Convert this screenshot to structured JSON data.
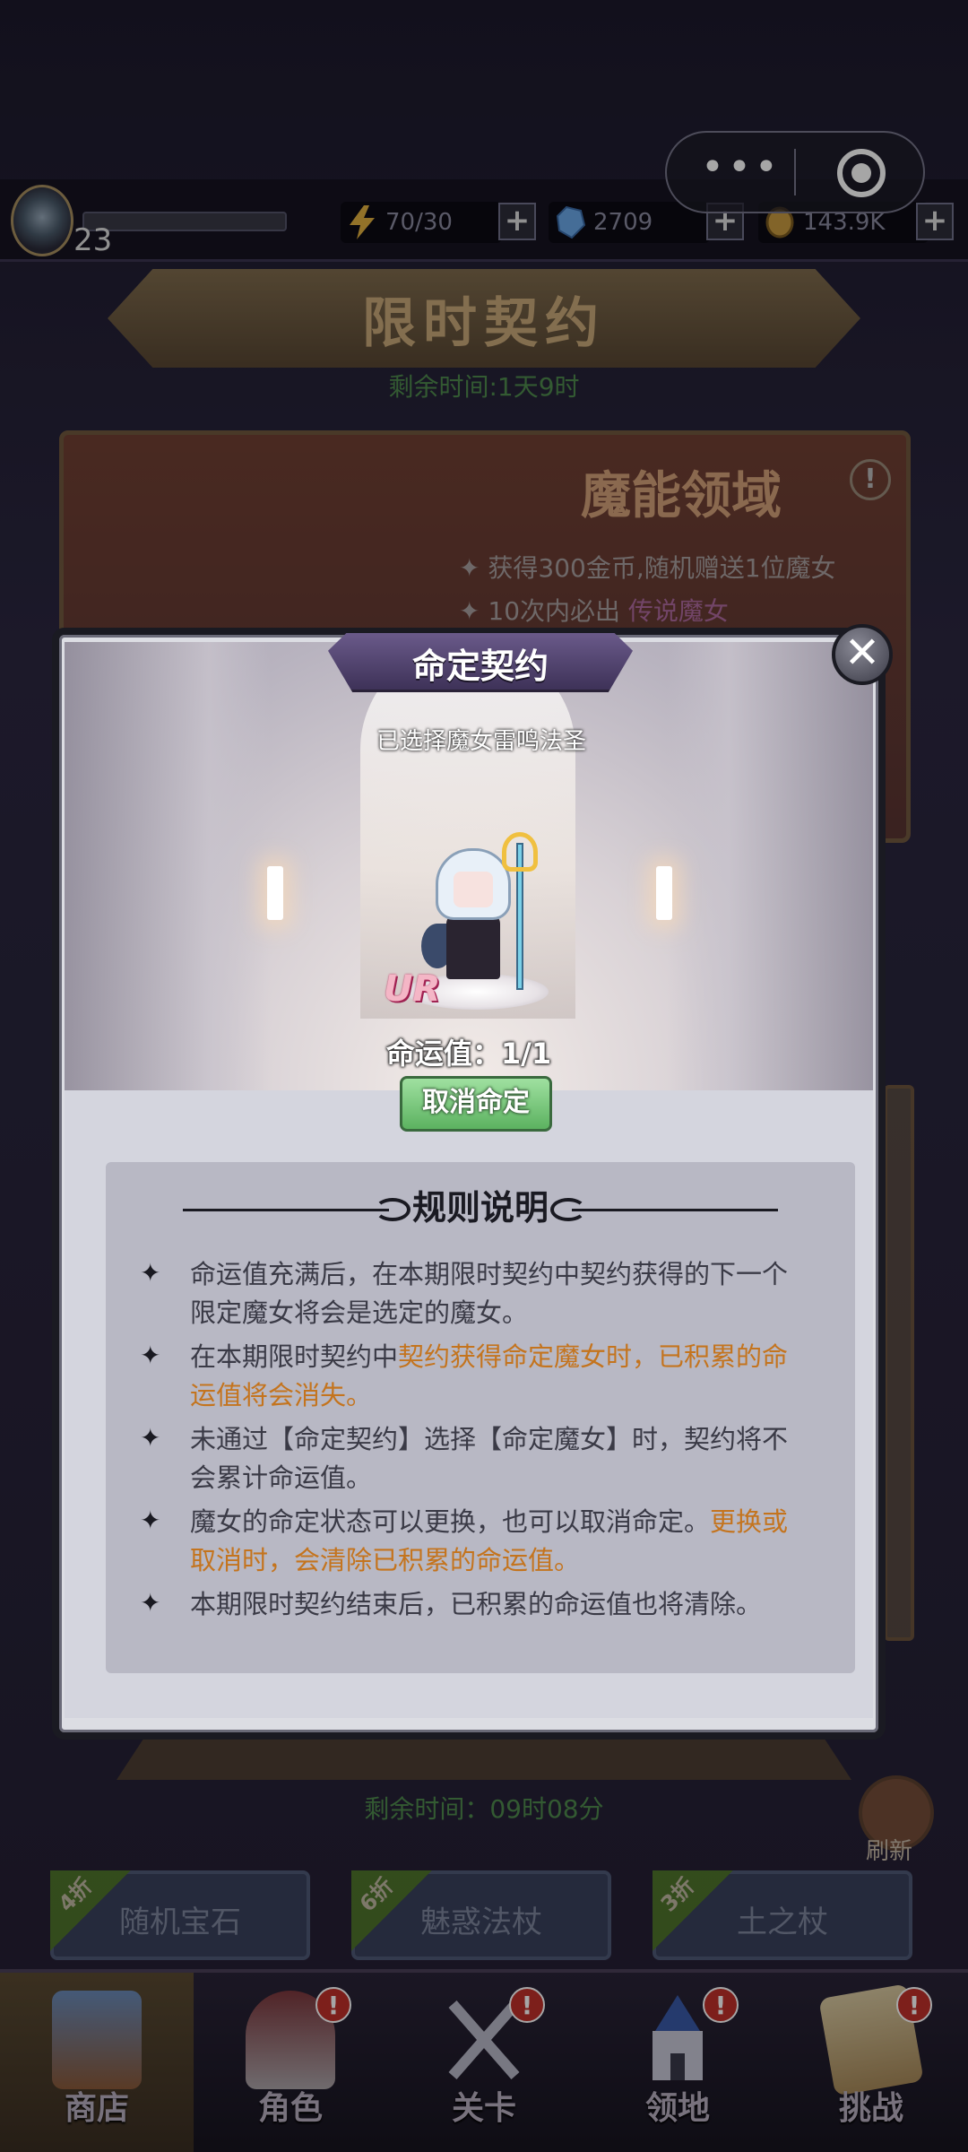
{
  "wechat_capsule": {
    "more": "•••",
    "close": "◎"
  },
  "status": {
    "level": "23",
    "energy": "70/30",
    "gems": "2709",
    "gold": "143.9K",
    "plus": "+"
  },
  "shop": {
    "banner_title": "限时契约",
    "banner_remaining": "剩余时间:1天9时",
    "event": {
      "title": "魔能领域",
      "line1": "获得300金币,随机赠送1位魔女",
      "line2_prefix": "10次内必出",
      "line2_highlight": "传说魔女"
    },
    "refresh_remaining": "剩余时间：09时08分",
    "refresh_label": "刷新",
    "items": [
      {
        "discount": "4折",
        "name": "随机宝石"
      },
      {
        "discount": "6折",
        "name": "魅惑法杖"
      },
      {
        "discount": "3折",
        "name": "土之杖"
      }
    ]
  },
  "nav": [
    {
      "label": "商店"
    },
    {
      "label": "角色",
      "badge": "!"
    },
    {
      "label": "关卡",
      "badge": "!"
    },
    {
      "label": "领地",
      "badge": "!"
    },
    {
      "label": "挑战",
      "badge": "!"
    }
  ],
  "modal": {
    "title": "命定契约",
    "close": "✕",
    "selected": "已选择魔女雷鸣法圣",
    "rarity": "UR",
    "fate_value": "命运值：1/1",
    "cancel_button": "取消命定",
    "rules_title": "规则说明",
    "rules": [
      {
        "a": "命运值充满后，在本期限时契约中契约获得的下一个限定魔女将会是选定的魔女。",
        "h": "",
        "b": ""
      },
      {
        "a": "在本期限时契约中",
        "h": "契约获得命定魔女时，已积累的命运值将会消失。",
        "b": ""
      },
      {
        "a": "未通过【命定契约】选择【命定魔女】时，契约将不会累计命运值。",
        "h": "",
        "b": ""
      },
      {
        "a": "魔女的命定状态可以更换，也可以取消命定。",
        "h": "更换或取消时，会清除已积累的命运值。",
        "b": ""
      },
      {
        "a": "本期限时契约结束后，已积累的命运值也将清除。",
        "h": "",
        "b": ""
      }
    ],
    "bullet": "✦"
  },
  "colors": {
    "highlight": "#c4741e",
    "button_green": "#5cb260",
    "badge_red": "#c0302a"
  },
  "icons": [
    "level-emblem-icon",
    "energy-bolt-icon",
    "gem-icon",
    "gold-coin-icon",
    "close-icon",
    "refresh-icon",
    "shop-icon",
    "character-icon",
    "stage-swords-icon",
    "territory-castle-icon",
    "challenge-scroll-icon"
  ]
}
